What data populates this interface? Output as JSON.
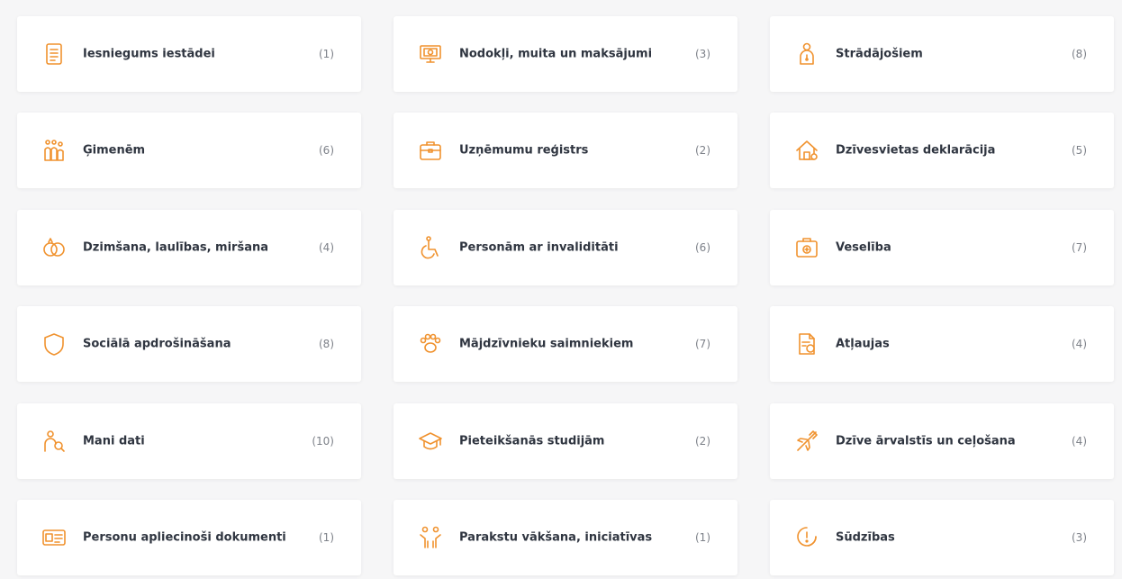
{
  "accent_color": "#f0922e",
  "categories": [
    {
      "label": "Iesniegums iestādei",
      "count": "(1)",
      "icon": "document-icon"
    },
    {
      "label": "Nodokļi, muita un maksājumi",
      "count": "(3)",
      "icon": "money-icon"
    },
    {
      "label": "Strādājošiem",
      "count": "(8)",
      "icon": "worker-icon"
    },
    {
      "label": "Ģimenēm",
      "count": "(6)",
      "icon": "family-icon"
    },
    {
      "label": "Uzņēmumu reģistrs",
      "count": "(2)",
      "icon": "briefcase-icon"
    },
    {
      "label": "Dzīvesvietas deklarācija",
      "count": "(5)",
      "icon": "house-icon"
    },
    {
      "label": "Dzimšana, laulības, miršana",
      "count": "(4)",
      "icon": "rings-icon"
    },
    {
      "label": "Personām ar invaliditāti",
      "count": "(6)",
      "icon": "wheelchair-icon"
    },
    {
      "label": "Veselība",
      "count": "(7)",
      "icon": "medical-kit-icon"
    },
    {
      "label": "Sociālā apdrošināšana",
      "count": "(8)",
      "icon": "shield-icon"
    },
    {
      "label": "Mājdzīvnieku saimniekiem",
      "count": "(7)",
      "icon": "paw-icon"
    },
    {
      "label": "Atļaujas",
      "count": "(4)",
      "icon": "permit-icon"
    },
    {
      "label": "Mani dati",
      "count": "(10)",
      "icon": "person-search-icon"
    },
    {
      "label": "Pieteikšanās studijām",
      "count": "(2)",
      "icon": "graduation-cap-icon"
    },
    {
      "label": "Dzīve ārvalstīs un ceļošana",
      "count": "(4)",
      "icon": "airplane-icon"
    },
    {
      "label": "Personu apliecinoši dokumenti",
      "count": "(1)",
      "icon": "id-card-icon"
    },
    {
      "label": "Parakstu vākšana, iniciatīvas",
      "count": "(1)",
      "icon": "raised-hands-icon"
    },
    {
      "label": "Sūdzības",
      "count": "(3)",
      "icon": "alert-bubble-icon"
    }
  ]
}
